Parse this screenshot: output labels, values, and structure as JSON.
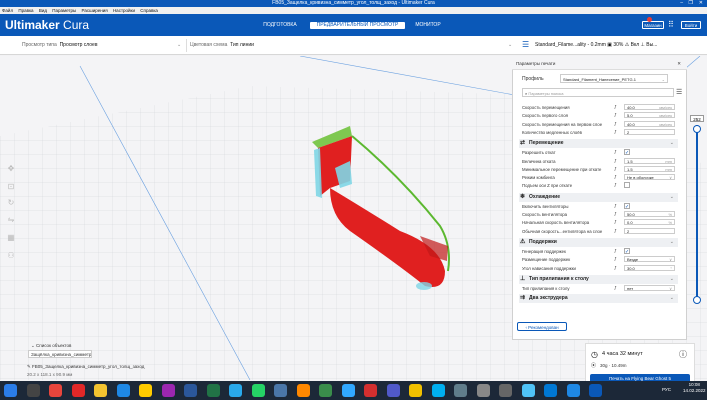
{
  "window": {
    "title": "FB05_Защелка_кривизна_симметр_угол_толщ_заход - Ultimaker Cura",
    "controls": [
      "–",
      "❐",
      "✕"
    ]
  },
  "menu": [
    "Файл",
    "Правка",
    "Вид",
    "Параметры",
    "Расширения",
    "Настройки",
    "Справка"
  ],
  "header": {
    "logo_bold": "Ultimaker",
    "logo_light": " Cura",
    "stages": [
      "ПОДГОТОВКА",
      "ПРЕДВАРИТЕЛЬНЫЙ ПРОСМОТР",
      "МОНИТОР"
    ],
    "active_stage": 1,
    "marketplace": "Магазин",
    "signin": "Войти"
  },
  "toolbar": {
    "view_type_label": "Просмотр типа",
    "view_type_value": "Просмотр слоев",
    "color_scheme_label": "Цветовая схема",
    "color_scheme_value": "Тип линии",
    "profile_summary": "Standard_Filame...ality - 0.2mm",
    "infill": "30%",
    "support": "Вкл",
    "adhesion": "Вы..."
  },
  "layer": {
    "current": "252"
  },
  "panel": {
    "title": "Параметры печати",
    "profile_label": "Профиль",
    "profile_value": "Standard_Filament_Нанесение_PETG.1",
    "search_placeholder": "Параметры поиска",
    "rows_top": [
      {
        "label": "Скорость перемещения",
        "value": "40.0",
        "unit": "мм/сек"
      },
      {
        "label": "Скорость первого слоя",
        "value": "5.0",
        "unit": "мм/сек"
      },
      {
        "label": "Скорость перемещения на первом слое",
        "value": "40.0",
        "unit": "мм/сек"
      },
      {
        "label": "Количество медленных слоёв",
        "value": "2",
        "unit": ""
      }
    ],
    "cat_travel": "Перемещение",
    "rows_travel": [
      {
        "label": "Разрешить откат",
        "value": "✓",
        "unit": "",
        "check": true
      },
      {
        "label": "Величина отката",
        "value": "1.5",
        "unit": "mm"
      },
      {
        "label": "Минимальное перемещение при откате",
        "value": "1.5",
        "unit": "mm"
      },
      {
        "label": "Режим комбинга",
        "value": "Не в оболочке",
        "unit": "∨"
      },
      {
        "label": "Подъем оси Z при откате",
        "value": "",
        "unit": "",
        "check": true
      }
    ],
    "cat_cooling": "Охлаждение",
    "rows_cooling": [
      {
        "label": "Включить вентиляторы",
        "value": "✓",
        "unit": "",
        "check": true
      },
      {
        "label": "Скорость вентилятора",
        "value": "50.0",
        "unit": "%"
      },
      {
        "label": "Начальная скорость вентилятора",
        "value": "0.0",
        "unit": "%"
      },
      {
        "label": "Обычная скорость...ентилятора на слое",
        "value": "2",
        "unit": ""
      }
    ],
    "cat_support": "Поддержки",
    "rows_support": [
      {
        "label": "Генерация поддержек",
        "value": "✓",
        "unit": "",
        "check": true
      },
      {
        "label": "Размещение поддержек",
        "value": "Везде",
        "unit": "∨"
      },
      {
        "label": "Угол нависания поддержки",
        "value": "30.0",
        "unit": "°"
      }
    ],
    "cat_adhesion": "Тип прилипания к столу",
    "rows_adhesion": [
      {
        "label": "Тип прилипания к столу",
        "value": "нет",
        "unit": "∨"
      }
    ],
    "cat_extruder": "Два экструдера",
    "recommended": "‹ Рекомендован"
  },
  "objects": {
    "list_label": "Список объектов",
    "item": "Защёлка_кривизна_симметр...",
    "file_name": "FB05_Защелка_кривизна_симметр_угол_толщ_заход",
    "dims": "20.2 x 118.1 x 90.9 мм"
  },
  "print": {
    "time": "4 часа 32 минут",
    "material": "30g · 10.49m",
    "button": "Печать на Flying Bear Ghost 5"
  },
  "taskbar": {
    "lang": "РУС",
    "time": "10:08",
    "date": "14.02.2022",
    "icons": [
      "start",
      "search",
      "chrome",
      "opera",
      "folder",
      "cura",
      "yandex",
      "photos",
      "word",
      "excel",
      "telegram",
      "whatsapp",
      "vk",
      "media",
      "ccleaner",
      "ps",
      "acrobat",
      "teams",
      "notes",
      "skype",
      "files",
      "settings",
      "calc",
      "cloud",
      "mail",
      "onedrive",
      "cura-active"
    ],
    "icon_colors": [
      "#2b7de9",
      "#444",
      "#e8453c",
      "#e22828",
      "#f4c430",
      "#1e88e5",
      "#ffcc00",
      "#9c27b0",
      "#2b579a",
      "#217346",
      "#29a9eb",
      "#25d366",
      "#4a76a8",
      "#ff8800",
      "#3a8d4b",
      "#31a8ff",
      "#d32f2f",
      "#5059c9",
      "#f0c000",
      "#00aff0",
      "#607d8b",
      "#888",
      "#666",
      "#4fc3f7",
      "#0078d4",
      "#1e88e5",
      "#0a58b8"
    ]
  }
}
